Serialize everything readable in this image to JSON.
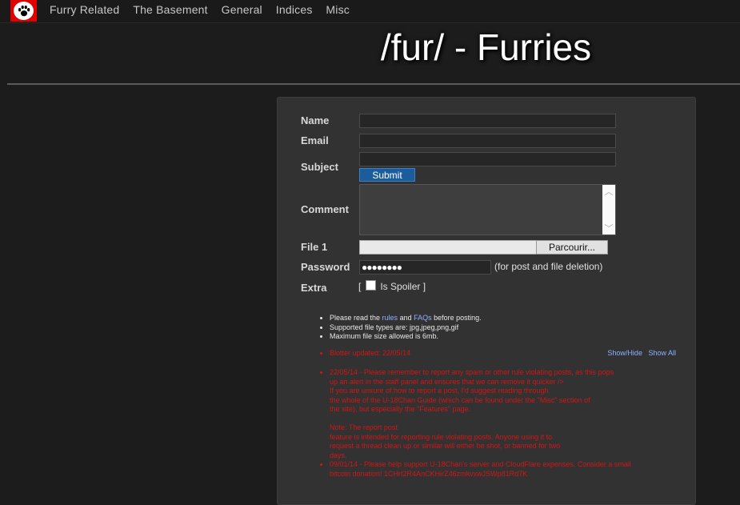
{
  "nav": {
    "logo": "paw-icon",
    "links": [
      "Furry Related",
      "The Basement",
      "General",
      "Indices",
      "Misc"
    ]
  },
  "board_title": "/fur/ - Furries",
  "form": {
    "name_label": "Name",
    "email_label": "Email",
    "subject_label": "Subject",
    "submit_label": "Submit",
    "comment_label": "Comment",
    "file_label": "File 1",
    "browse_label": "Parcourir...",
    "password_label": "Password",
    "password_value": "●●●●●●●●",
    "password_note": "(for post and file deletion)",
    "extra_label": "Extra",
    "spoiler_open": "[",
    "spoiler_label": "Is Spoiler ]"
  },
  "info": {
    "rules_prefix": "Please read the ",
    "rules_link": "rules",
    "rules_mid": " and ",
    "faq_link": "FAQs",
    "rules_suffix": " before posting.",
    "file_types": "Supported file types are: jpg,jpeg,png,gif",
    "max_size": "Maximum file size allowed is 6mb."
  },
  "blotter": {
    "updated": "Blotter updated: 22/05/14",
    "show_hide": "Show/Hide",
    "show_all": "Show All",
    "entries": [
      "22/05/14 - Please remember to report any spam or other rule violating posts, as this pops\nup an alert in the staff panel and ensures that we can remove it quicker />\nIf you are unsure of how to report a post, I'd suggest reading through\nthe whole of the U-18Chan Guide (which can be found under the \"Misc\" section of\nthe site), but especially the \"Features\" page.\n\nNote: The report post\nfeature is intended for reporting rule violating posts. Anyone using it to\nrequest a thread clean up or similar will either be shot, or banned for two\ndays.",
      "09/01/14 - Please help support U-18Chan's server and CloudFlare expenses. Consider a small\nbitcoin donation! 1CHrt2R4AnCKHirZ46zmkvxwJSWp81Rd7K"
    ]
  }
}
